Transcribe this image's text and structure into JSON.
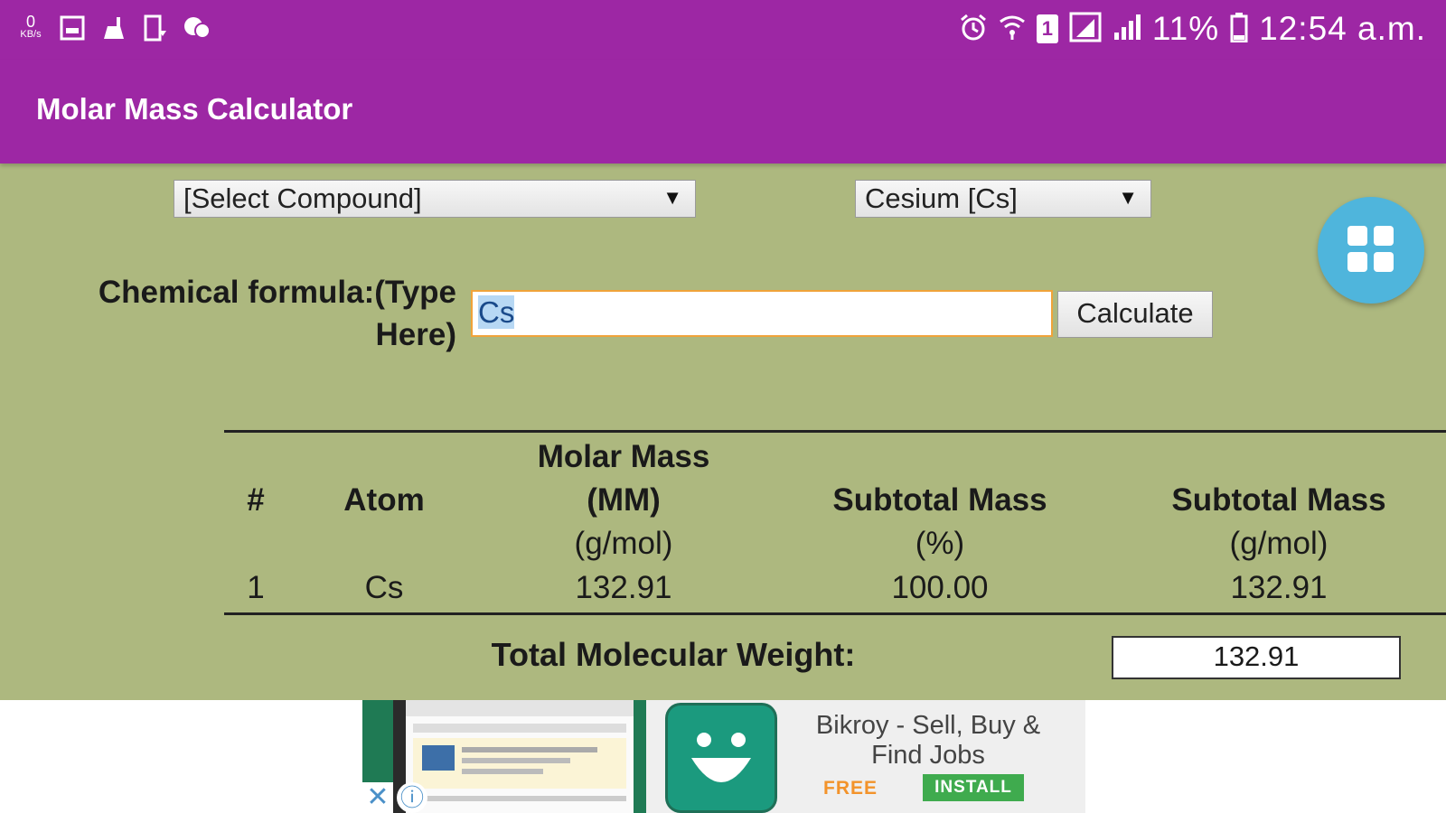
{
  "status_bar": {
    "left_icons": [
      "data-speed-icon",
      "image-icon",
      "cleaner-icon",
      "phone-download-icon",
      "chat-icon"
    ],
    "data_speed": "0",
    "data_speed_unit": "KB/s",
    "right_icons": [
      "alarm-icon",
      "wifi-icon",
      "sim1-icon",
      "signal-icon",
      "signal-icon",
      "battery-icon"
    ],
    "sim_label": "1",
    "battery": "11%",
    "time": "12:54 a.m."
  },
  "app_bar": {
    "title": "Molar Mass Calculator"
  },
  "compound_select": {
    "value": "[Select Compound]",
    "arrow": "▼"
  },
  "element_select": {
    "value": "Cesium [Cs]",
    "arrow": "▼"
  },
  "fab": {
    "icon": "grid-icon"
  },
  "formula": {
    "label_line1": "Chemical formula:(Type",
    "label_line2": "Here)",
    "value": "Cs",
    "calculate_label": "Calculate"
  },
  "table": {
    "headers": {
      "num": "#",
      "atom": "Atom",
      "mm_line1": "Molar Mass",
      "mm_line2": "(MM)",
      "mm_unit": "(g/mol)",
      "pct_line1": "Subtotal Mass",
      "pct_unit": "(%)",
      "sub_line1": "Subtotal Mass",
      "sub_unit": "(g/mol)"
    },
    "rows": [
      {
        "num": "1",
        "atom": "Cs",
        "molar_mass": "132.91",
        "subtotal_pct": "100.00",
        "subtotal_mass": "132.91"
      }
    ]
  },
  "total": {
    "label": "Total Molecular Weight:",
    "value": "132.91"
  },
  "ad": {
    "title": "Bikroy - Sell, Buy & Find Jobs",
    "free": "FREE",
    "install": "INSTALL",
    "close_icon": "close-icon",
    "info_icon": "info-icon",
    "logo_icon": "bikroy-smile-icon"
  },
  "colors": {
    "app_bar": "#9d27a4",
    "background": "#adb87f",
    "fab": "#4fb5dc",
    "input_focus_border": "#f0a33a",
    "install_button": "#3fab4e",
    "free_text": "#f3932a"
  }
}
